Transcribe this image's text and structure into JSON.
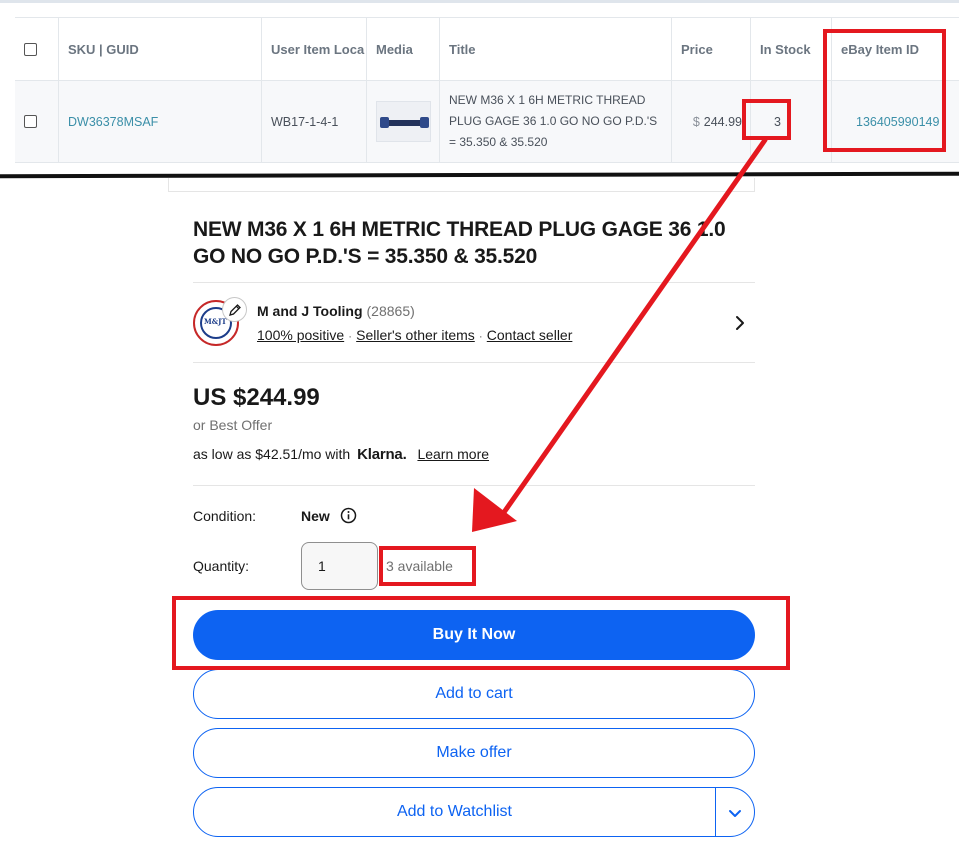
{
  "inventory_table": {
    "headers": {
      "sku": "SKU | GUID",
      "location": "User Item Loca",
      "media": "Media",
      "title": "Title",
      "price": "Price",
      "in_stock": "In Stock",
      "ebay_item_id": "eBay Item ID"
    },
    "row": {
      "sku": "DW36378MSAF",
      "location": "WB17-1-4-1",
      "media_icon": "thread-plug-gage-thumbnail",
      "title": "NEW M36 X 1 6H METRIC THREAD PLUG GAGE 36 1.0 GO NO GO P.D.'S = 35.350 & 35.520",
      "price_currency": "$",
      "price_value": "244.99",
      "in_stock": "3",
      "ebay_item_id": "136405990149"
    }
  },
  "listing": {
    "title": "NEW M36 X 1 6H METRIC THREAD PLUG GAGE 36 1.0 GO NO GO P.D.'S = 35.350 & 35.520",
    "seller": {
      "name": "M and J Tooling",
      "feedback_count": "(28865)",
      "positive": "100% positive",
      "other_items": "Seller's other items",
      "contact": "Contact seller",
      "logo_text": "M&JT",
      "edit_icon": "pencil-icon",
      "chevron_icon": "chevron-right-icon"
    },
    "price": "US $244.99",
    "best_offer": "or Best Offer",
    "klarna": {
      "prefix": "as low as $42.51/mo with",
      "brand": "Klarna.",
      "learn_more": "Learn more"
    },
    "condition": {
      "label": "Condition:",
      "value": "New",
      "info_icon": "info-icon"
    },
    "quantity": {
      "label": "Quantity:",
      "value": "1",
      "available": "3 available"
    },
    "buttons": {
      "buy_now": "Buy It Now",
      "add_to_cart": "Add to cart",
      "make_offer": "Make offer",
      "watchlist": "Add to Watchlist",
      "watchlist_chevron": "chevron-down-icon"
    }
  },
  "annotations": {
    "color": "#e4181f",
    "highlights": [
      "in-stock-count",
      "ebay-item-id",
      "quantity-available",
      "buy-it-now"
    ]
  }
}
